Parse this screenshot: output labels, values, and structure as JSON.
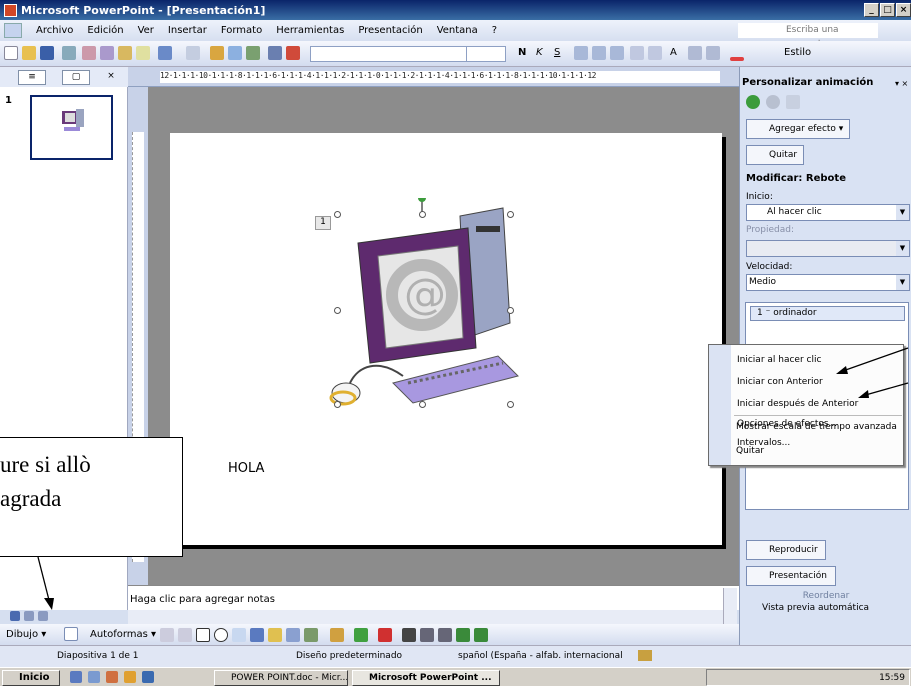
{
  "window": {
    "title": "Microsoft PowerPoint - [Presentación1]",
    "buttons": [
      "_",
      "□",
      "×"
    ]
  },
  "menu": {
    "items": [
      "Archivo",
      "Edición",
      "Ver",
      "Insertar",
      "Formato",
      "Herramientas",
      "Presentación",
      "Ventana",
      "?"
    ],
    "ask_placeholder": "Escriba una pregunta"
  },
  "toolbar": {
    "bold": "N",
    "italic": "K",
    "underline": "S",
    "font_size_step": "A",
    "style": "Estilo"
  },
  "tabs": {
    "outline": "≡",
    "slides": "▢",
    "close": "×"
  },
  "thumbnail": {
    "number": "1"
  },
  "ruler": {
    "text": "12·1·1·1·10·1·1·1·8·1·1·1·6·1·1·1·4·1·1·1·2·1·1·1·0·1·1·1·2·1·1·1·4·1·1·1·6·1·1·1·8·1·1·1·10·1·1·1·12"
  },
  "slide": {
    "text": "HOLA",
    "anim_tag": "1"
  },
  "notes": {
    "placeholder": "Haga clic para agregar notas"
  },
  "drawbar": {
    "draw": "Dibujo ▾",
    "autoshapes": "Autoformas ▾"
  },
  "status": {
    "slide": "Diapositiva 1 de 1",
    "design": "Diseño predeterminado",
    "language": "spañol (España - alfab. internacional"
  },
  "taskbar": {
    "start": "Inicio",
    "tasks": [
      "POWER POINT.doc - Micr...",
      "Microsoft PowerPoint ..."
    ],
    "clock": "15:59"
  },
  "taskpane": {
    "title": "Personalizar animación",
    "add_effect": "Agregar efecto ▾",
    "remove": "Quitar",
    "modify_title": "Modificar: Rebote",
    "start_label": "Inicio:",
    "start_value": "Al hacer clic",
    "property_label": "Propiedad:",
    "speed_label": "Velocidad:",
    "speed_value": "Medio",
    "anim_item": "1 ⁻ ordinador",
    "reorder": "Reordenar",
    "play": "Reproducir",
    "slideshow": "Presentación",
    "autopreview": "Vista previa automática"
  },
  "context_menu": {
    "items": [
      "Iniciar al hacer clic",
      "Iniciar con Anterior",
      "Iniciar después de Anterior",
      "Opciones de efectos...",
      "Intervalos...",
      "Mostrar escala de tiempo avanzada",
      "Quitar"
    ]
  },
  "callout": {
    "line1": "ure si allò",
    "line2": "agrada"
  }
}
